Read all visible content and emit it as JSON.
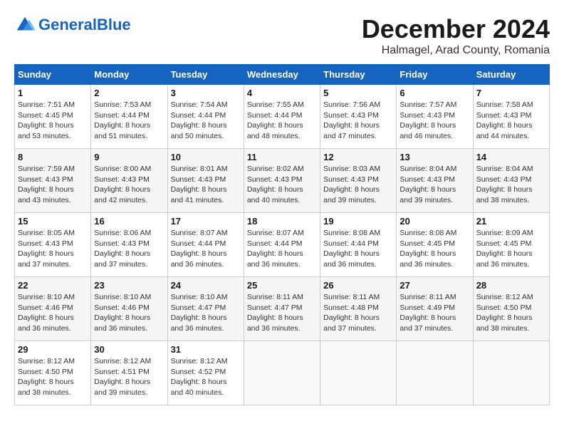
{
  "logo": {
    "text_general": "General",
    "text_blue": "Blue"
  },
  "title": "December 2024",
  "subtitle": "Halmagel, Arad County, Romania",
  "days_of_week": [
    "Sunday",
    "Monday",
    "Tuesday",
    "Wednesday",
    "Thursday",
    "Friday",
    "Saturday"
  ],
  "weeks": [
    [
      {
        "day": 1,
        "sunrise": "7:51 AM",
        "sunset": "4:45 PM",
        "daylight": "8 hours and 53 minutes."
      },
      {
        "day": 2,
        "sunrise": "7:53 AM",
        "sunset": "4:44 PM",
        "daylight": "8 hours and 51 minutes."
      },
      {
        "day": 3,
        "sunrise": "7:54 AM",
        "sunset": "4:44 PM",
        "daylight": "8 hours and 50 minutes."
      },
      {
        "day": 4,
        "sunrise": "7:55 AM",
        "sunset": "4:44 PM",
        "daylight": "8 hours and 48 minutes."
      },
      {
        "day": 5,
        "sunrise": "7:56 AM",
        "sunset": "4:43 PM",
        "daylight": "8 hours and 47 minutes."
      },
      {
        "day": 6,
        "sunrise": "7:57 AM",
        "sunset": "4:43 PM",
        "daylight": "8 hours and 46 minutes."
      },
      {
        "day": 7,
        "sunrise": "7:58 AM",
        "sunset": "4:43 PM",
        "daylight": "8 hours and 44 minutes."
      }
    ],
    [
      {
        "day": 8,
        "sunrise": "7:59 AM",
        "sunset": "4:43 PM",
        "daylight": "8 hours and 43 minutes."
      },
      {
        "day": 9,
        "sunrise": "8:00 AM",
        "sunset": "4:43 PM",
        "daylight": "8 hours and 42 minutes."
      },
      {
        "day": 10,
        "sunrise": "8:01 AM",
        "sunset": "4:43 PM",
        "daylight": "8 hours and 41 minutes."
      },
      {
        "day": 11,
        "sunrise": "8:02 AM",
        "sunset": "4:43 PM",
        "daylight": "8 hours and 40 minutes."
      },
      {
        "day": 12,
        "sunrise": "8:03 AM",
        "sunset": "4:43 PM",
        "daylight": "8 hours and 39 minutes."
      },
      {
        "day": 13,
        "sunrise": "8:04 AM",
        "sunset": "4:43 PM",
        "daylight": "8 hours and 39 minutes."
      },
      {
        "day": 14,
        "sunrise": "8:04 AM",
        "sunset": "4:43 PM",
        "daylight": "8 hours and 38 minutes."
      }
    ],
    [
      {
        "day": 15,
        "sunrise": "8:05 AM",
        "sunset": "4:43 PM",
        "daylight": "8 hours and 37 minutes."
      },
      {
        "day": 16,
        "sunrise": "8:06 AM",
        "sunset": "4:43 PM",
        "daylight": "8 hours and 37 minutes."
      },
      {
        "day": 17,
        "sunrise": "8:07 AM",
        "sunset": "4:44 PM",
        "daylight": "8 hours and 36 minutes."
      },
      {
        "day": 18,
        "sunrise": "8:07 AM",
        "sunset": "4:44 PM",
        "daylight": "8 hours and 36 minutes."
      },
      {
        "day": 19,
        "sunrise": "8:08 AM",
        "sunset": "4:44 PM",
        "daylight": "8 hours and 36 minutes."
      },
      {
        "day": 20,
        "sunrise": "8:08 AM",
        "sunset": "4:45 PM",
        "daylight": "8 hours and 36 minutes."
      },
      {
        "day": 21,
        "sunrise": "8:09 AM",
        "sunset": "4:45 PM",
        "daylight": "8 hours and 36 minutes."
      }
    ],
    [
      {
        "day": 22,
        "sunrise": "8:10 AM",
        "sunset": "4:46 PM",
        "daylight": "8 hours and 36 minutes."
      },
      {
        "day": 23,
        "sunrise": "8:10 AM",
        "sunset": "4:46 PM",
        "daylight": "8 hours and 36 minutes."
      },
      {
        "day": 24,
        "sunrise": "8:10 AM",
        "sunset": "4:47 PM",
        "daylight": "8 hours and 36 minutes."
      },
      {
        "day": 25,
        "sunrise": "8:11 AM",
        "sunset": "4:47 PM",
        "daylight": "8 hours and 36 minutes."
      },
      {
        "day": 26,
        "sunrise": "8:11 AM",
        "sunset": "4:48 PM",
        "daylight": "8 hours and 37 minutes."
      },
      {
        "day": 27,
        "sunrise": "8:11 AM",
        "sunset": "4:49 PM",
        "daylight": "8 hours and 37 minutes."
      },
      {
        "day": 28,
        "sunrise": "8:12 AM",
        "sunset": "4:50 PM",
        "daylight": "8 hours and 38 minutes."
      }
    ],
    [
      {
        "day": 29,
        "sunrise": "8:12 AM",
        "sunset": "4:50 PM",
        "daylight": "8 hours and 38 minutes."
      },
      {
        "day": 30,
        "sunrise": "8:12 AM",
        "sunset": "4:51 PM",
        "daylight": "8 hours and 39 minutes."
      },
      {
        "day": 31,
        "sunrise": "8:12 AM",
        "sunset": "4:52 PM",
        "daylight": "8 hours and 40 minutes."
      },
      null,
      null,
      null,
      null
    ]
  ]
}
